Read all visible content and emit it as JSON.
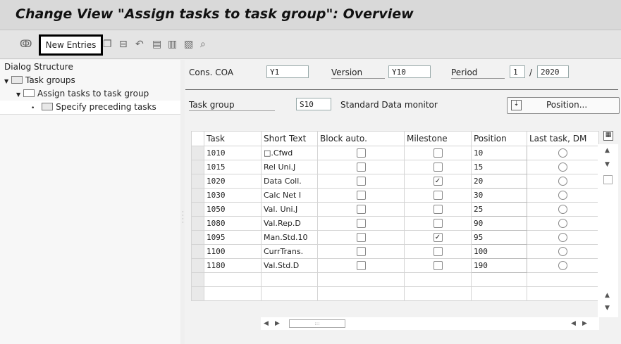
{
  "title": "Change View \"Assign tasks to task group\": Overview",
  "toolbar": {
    "new_entries": "New Entries"
  },
  "dialog": {
    "heading": "Dialog Structure",
    "items": [
      "Task groups",
      "Assign tasks to task group",
      "Specify preceding tasks"
    ]
  },
  "header": {
    "cons_coa_label": "Cons. COA",
    "cons_coa_value": "Y1",
    "version_label": "Version",
    "version_value": "Y10",
    "period_label": "Period",
    "period_value": "1",
    "period_sep": "/",
    "year_value": "2020",
    "task_group_label": "Task group",
    "task_group_value": "S10",
    "task_group_text": "Standard Data monitor",
    "position_button": "Position..."
  },
  "table": {
    "columns": [
      "Task",
      "Short Text",
      "Block auto.",
      "Milestone",
      "Position",
      "Last task, DM"
    ],
    "rows": [
      {
        "task": "1010",
        "short": "□.Cfwd",
        "block": false,
        "milestone": false,
        "position": "10"
      },
      {
        "task": "1015",
        "short": "Rel Uni.J",
        "block": false,
        "milestone": false,
        "position": "15"
      },
      {
        "task": "1020",
        "short": "Data Coll.",
        "block": false,
        "milestone": true,
        "position": "20"
      },
      {
        "task": "1030",
        "short": "Calc Net I",
        "block": false,
        "milestone": false,
        "position": "30"
      },
      {
        "task": "1050",
        "short": "Val. Uni.J",
        "block": false,
        "milestone": false,
        "position": "25"
      },
      {
        "task": "1080",
        "short": "Val.Rep.D",
        "block": false,
        "milestone": false,
        "position": "90"
      },
      {
        "task": "1095",
        "short": "Man.Std.10",
        "block": false,
        "milestone": true,
        "position": "95"
      },
      {
        "task": "1100",
        "short": "CurrTrans.",
        "block": false,
        "milestone": false,
        "position": "100"
      },
      {
        "task": "1180",
        "short": "Val.Std.D",
        "block": false,
        "milestone": false,
        "position": "190"
      }
    ],
    "empty_rows": 2
  }
}
